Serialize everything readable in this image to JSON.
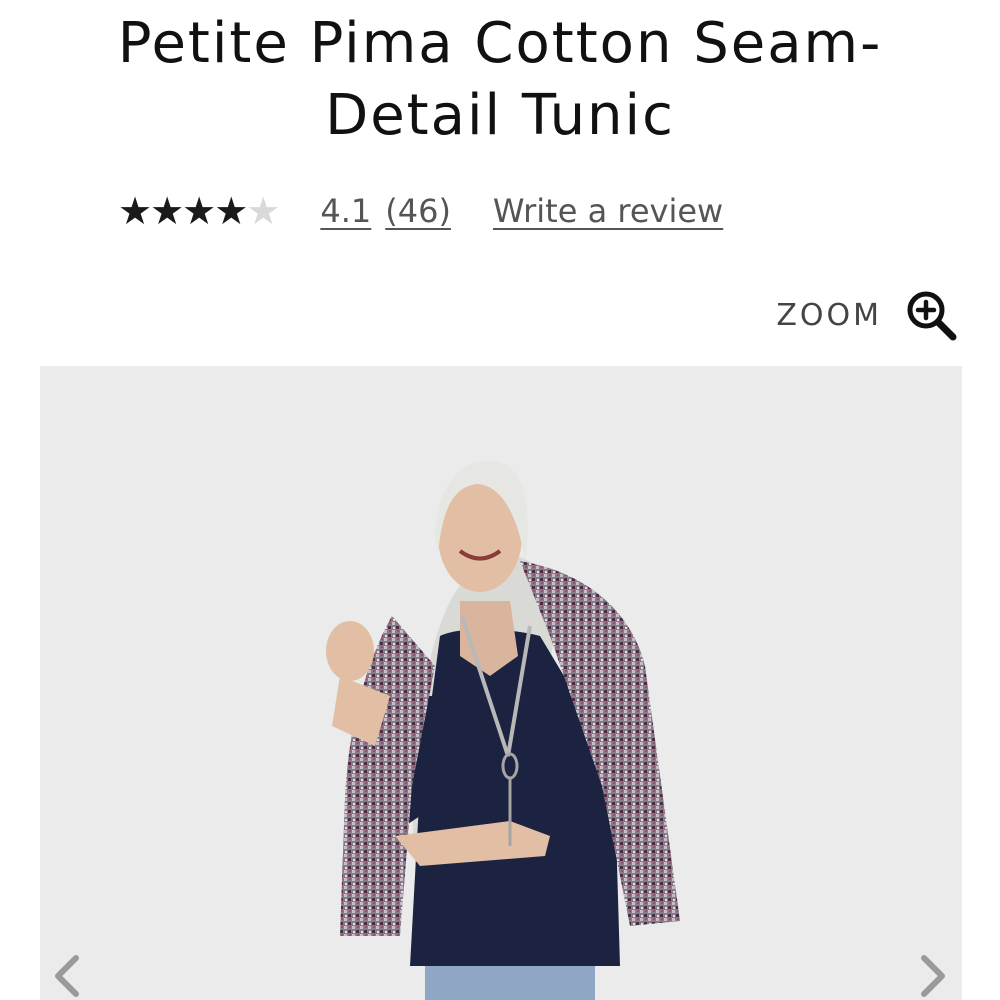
{
  "product": {
    "title_line1": "Petite Pima Cotton Seam-",
    "title_line2": "Detail Tunic"
  },
  "rating": {
    "stars_total": 5,
    "stars_filled_fraction": 0.82,
    "average": "4.1",
    "count": "(46)",
    "write_review_label": "Write a review"
  },
  "zoom": {
    "label": "ZOOM",
    "icon": "zoom-in-icon"
  },
  "gallery": {
    "prev_icon": "chevron-left-icon",
    "next_icon": "chevron-right-icon",
    "background_color": "#ebebeb"
  }
}
